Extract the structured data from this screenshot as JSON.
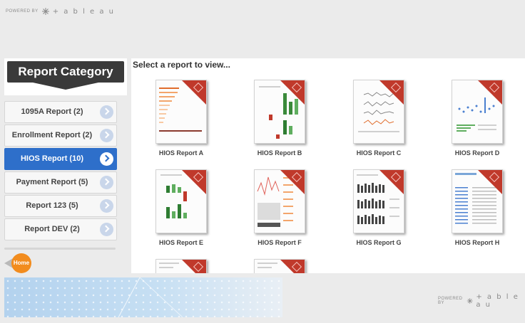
{
  "header": {
    "powered_by": "POWERED BY",
    "brand": "+ a b l e a u"
  },
  "sidebar": {
    "title": "Report Category",
    "items": [
      {
        "label": "1095A Report (2)",
        "active": false
      },
      {
        "label": "Enrollment Report (2)",
        "active": false
      },
      {
        "label": "HIOS Report (10)",
        "active": true
      },
      {
        "label": "Payment Report (5)",
        "active": false
      },
      {
        "label": "Report 123 (5)",
        "active": false
      },
      {
        "label": "Report DEV (2)",
        "active": false
      }
    ],
    "home_label": "Home"
  },
  "main": {
    "title": "Select a report to view...",
    "reports": [
      {
        "label": "HIOS Report A",
        "icon": "horizontal-bar-report-thumbnail"
      },
      {
        "label": "HIOS Report B",
        "icon": "bar-chart-report-thumbnail"
      },
      {
        "label": "HIOS Report C",
        "icon": "line-chart-report-thumbnail"
      },
      {
        "label": "HIOS Report D",
        "icon": "scatter-chart-report-thumbnail"
      },
      {
        "label": "HIOS Report E",
        "icon": "bar-chart-report-thumbnail"
      },
      {
        "label": "HIOS Report F",
        "icon": "line-area-report-thumbnail"
      },
      {
        "label": "HIOS Report G",
        "icon": "column-chart-report-thumbnail"
      },
      {
        "label": "HIOS Report H",
        "icon": "table-report-thumbnail"
      },
      {
        "label": "",
        "icon": "report-thumbnail"
      },
      {
        "label": "",
        "icon": "report-thumbnail"
      }
    ]
  },
  "footer": {
    "powered_by": "POWERED BY",
    "brand": "+ a b l e a u"
  },
  "colors": {
    "active": "#2e6fca",
    "accent_red": "#c0392b",
    "home_orange": "#f28c1e"
  }
}
